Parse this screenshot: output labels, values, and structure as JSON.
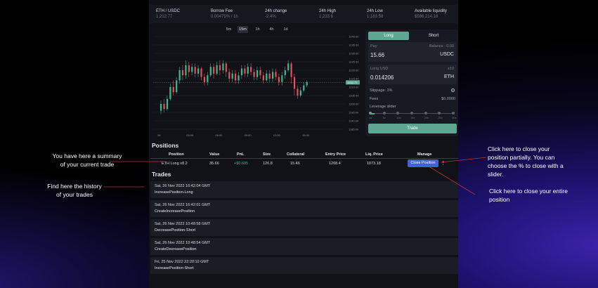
{
  "stats": [
    {
      "label": "ETH / USDC",
      "value": "1,212.77"
    },
    {
      "label": "Borrow Fee",
      "value": "0.00475% / 1h"
    },
    {
      "label": "24h change",
      "value": "-2.4%"
    },
    {
      "label": "24h High",
      "value": "1,233.6"
    },
    {
      "label": "24h Low",
      "value": "1,183.58"
    },
    {
      "label": "Available liquidity",
      "value": "$586,214.18"
    }
  ],
  "timeframes": [
    "5m",
    "15m",
    "1h",
    "4h",
    "1d"
  ],
  "active_timeframe": "15m",
  "chart_data": {
    "type": "candlestick",
    "price_axis": [
      "1240.00",
      "1235.00",
      "1230.00",
      "1225.00",
      "1220.00",
      "1215.00",
      "1210.00",
      "1205.00",
      "1200.00",
      "1195.00",
      "1190.00",
      "1185.00"
    ],
    "current_price_label": "1212.77",
    "time_axis": [
      "26",
      "03:00",
      "06:00",
      "09:00",
      "12:00",
      "15:00"
    ],
    "up_color": "#3fb68b",
    "down_color": "#e05260",
    "candles": [
      [
        1196,
        1200,
        1194,
        1202
      ],
      [
        1200,
        1197,
        1195,
        1203
      ],
      [
        1197,
        1203,
        1196,
        1205
      ],
      [
        1203,
        1210,
        1202,
        1212
      ],
      [
        1210,
        1207,
        1205,
        1214
      ],
      [
        1207,
        1214,
        1206,
        1216
      ],
      [
        1214,
        1220,
        1212,
        1222
      ],
      [
        1220,
        1217,
        1214,
        1223
      ],
      [
        1217,
        1223,
        1215,
        1226
      ],
      [
        1223,
        1219,
        1216,
        1225
      ],
      [
        1219,
        1222,
        1217,
        1224
      ],
      [
        1222,
        1218,
        1216,
        1224
      ],
      [
        1218,
        1221,
        1216,
        1223
      ],
      [
        1221,
        1216,
        1214,
        1222
      ],
      [
        1216,
        1213,
        1211,
        1218
      ],
      [
        1213,
        1217,
        1211,
        1219
      ],
      [
        1217,
        1222,
        1216,
        1224
      ],
      [
        1222,
        1218,
        1215,
        1224
      ],
      [
        1218,
        1223,
        1217,
        1225
      ],
      [
        1223,
        1220,
        1217,
        1226
      ],
      [
        1220,
        1224,
        1218,
        1226
      ],
      [
        1224,
        1219,
        1216,
        1225
      ],
      [
        1219,
        1215,
        1213,
        1221
      ],
      [
        1215,
        1218,
        1213,
        1220
      ],
      [
        1218,
        1214,
        1212,
        1220
      ],
      [
        1214,
        1217,
        1212,
        1219
      ],
      [
        1217,
        1221,
        1215,
        1223
      ],
      [
        1221,
        1218,
        1216,
        1223
      ],
      [
        1218,
        1222,
        1216,
        1224
      ],
      [
        1222,
        1219,
        1217,
        1224
      ],
      [
        1219,
        1216,
        1214,
        1221
      ],
      [
        1216,
        1220,
        1214,
        1222
      ],
      [
        1220,
        1217,
        1215,
        1222
      ],
      [
        1217,
        1214,
        1212,
        1219
      ],
      [
        1214,
        1218,
        1213,
        1220
      ],
      [
        1218,
        1215,
        1213,
        1220
      ],
      [
        1215,
        1219,
        1213,
        1221
      ],
      [
        1219,
        1216,
        1214,
        1221
      ],
      [
        1216,
        1213,
        1211,
        1218
      ],
      [
        1213,
        1217,
        1211,
        1219
      ],
      [
        1217,
        1220,
        1215,
        1222
      ],
      [
        1220,
        1224,
        1219,
        1226
      ],
      [
        1224,
        1216,
        1212,
        1225
      ],
      [
        1216,
        1209,
        1205,
        1218
      ],
      [
        1209,
        1205,
        1203,
        1211
      ],
      [
        1205,
        1208,
        1204,
        1210
      ],
      [
        1208,
        1211,
        1207,
        1213
      ],
      [
        1211,
        1213,
        1210,
        1214
      ]
    ]
  },
  "panel": {
    "long_tab": "Long",
    "short_tab": "Short",
    "pay_label": "Pay",
    "balance_label": "Balance : 0.00",
    "pay_value": "15.66",
    "pay_token": "USDC",
    "long_label": "Long USD",
    "leverage_label": "x10",
    "long_value": "0.014206",
    "long_token": "ETH",
    "slippage_label": "Slippage: 1%",
    "fees_label": "Fees",
    "fees_value": "$0.0000",
    "leverage_slider_label": "Leverage slider",
    "slider_ticks": [
      "1x",
      "5x",
      "10x",
      "15x",
      "20x",
      "25x",
      "30x"
    ],
    "leverage_level": 0.05,
    "trade_button": "Trade",
    "accent_color": "#5fa690"
  },
  "positions": {
    "title": "Positions",
    "headers": [
      "Position",
      "Value",
      "PnL",
      "Size",
      "Collateral",
      "Entry Price",
      "Liq. Price",
      "Manage"
    ],
    "row": {
      "position": "ETH Long x8.2",
      "value": "35.66",
      "pnl": "+$0.605",
      "size": "126.8",
      "collateral": "15.46",
      "entry_price": "1208.4",
      "liq_price": "1073.18"
    },
    "close_button": "Close Position",
    "pnl_color": "#3fb68b"
  },
  "trades": {
    "title": "Trades",
    "items": [
      {
        "date": "Sat, 26 Nov 2022 16:42:04 GMT",
        "action": "IncreasePosition-Long"
      },
      {
        "date": "Sat, 26 Nov 2022 16:42:01 GMT",
        "action": "CreateIncreasePosition"
      },
      {
        "date": "Sat, 26 Nov 2022 10:48:58 GMT",
        "action": "DecreasePosition-Short"
      },
      {
        "date": "Sat, 26 Nov 2022 10:48:54 GMT",
        "action": "CreateDecreasePosition"
      },
      {
        "date": "Fri, 25 Nov 2022 22:20:10 GMT",
        "action": "IncreasePosition-Short"
      }
    ]
  },
  "annotations": {
    "summary": [
      "You have here a summary",
      "of your current trade"
    ],
    "history": [
      "Find here the history",
      "of your trades"
    ],
    "partial": [
      "Click here to close your",
      "position partially. You can",
      "choose the % to close with a",
      "slider."
    ],
    "entire": [
      "Click here to close your entire",
      "position"
    ],
    "line_color": "#c0303a"
  }
}
